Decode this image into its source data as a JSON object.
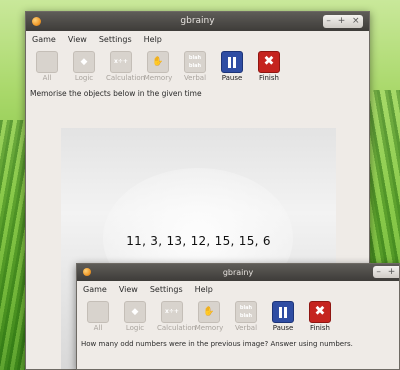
{
  "window_main": {
    "title": "gbrainy",
    "controls": [
      "–",
      "+",
      "×"
    ],
    "menu": [
      "Game",
      "View",
      "Settings",
      "Help"
    ],
    "toolbar": [
      {
        "label": "All",
        "icon": "all-icon",
        "active": false
      },
      {
        "label": "Logic",
        "icon": "logic-icon",
        "active": false
      },
      {
        "label": "Calculation",
        "icon": "calculation-icon",
        "active": false
      },
      {
        "label": "Memory",
        "icon": "memory-icon",
        "active": false
      },
      {
        "label": "Verbal",
        "icon": "verbal-icon",
        "active": false
      },
      {
        "label": "Pause",
        "icon": "pause-icon",
        "active": true
      },
      {
        "label": "Finish",
        "icon": "finish-icon",
        "active": true
      }
    ],
    "icon_text": {
      "calculation": "x÷+",
      "verbal": "blah blah"
    },
    "instruction": "Memorise the objects below in the given time",
    "numbers": "11, 3, 13, 12, 15, 15, 6"
  },
  "window_second": {
    "title": "gbrainy",
    "controls": [
      "–",
      "+",
      "×"
    ],
    "menu": [
      "Game",
      "View",
      "Settings",
      "Help"
    ],
    "toolbar": [
      {
        "label": "All",
        "icon": "all-icon",
        "active": false
      },
      {
        "label": "Logic",
        "icon": "logic-icon",
        "active": false
      },
      {
        "label": "Calculation",
        "icon": "calculation-icon",
        "active": false
      },
      {
        "label": "Memory",
        "icon": "memory-icon",
        "active": false
      },
      {
        "label": "Verbal",
        "icon": "verbal-icon",
        "active": false
      },
      {
        "label": "Pause",
        "icon": "pause-icon",
        "active": true
      },
      {
        "label": "Finish",
        "icon": "finish-icon",
        "active": true
      }
    ],
    "icon_text": {
      "calculation": "x÷+",
      "verbal": "blah blah"
    },
    "instruction": "How many odd numbers were in the previous image? Answer using numbers."
  },
  "colors": {
    "titlebar": "#3e3c39",
    "window_bg": "#efebe7",
    "pause": "#2f4da3",
    "finish": "#c5241f",
    "close_dot": "#f09a2a"
  }
}
